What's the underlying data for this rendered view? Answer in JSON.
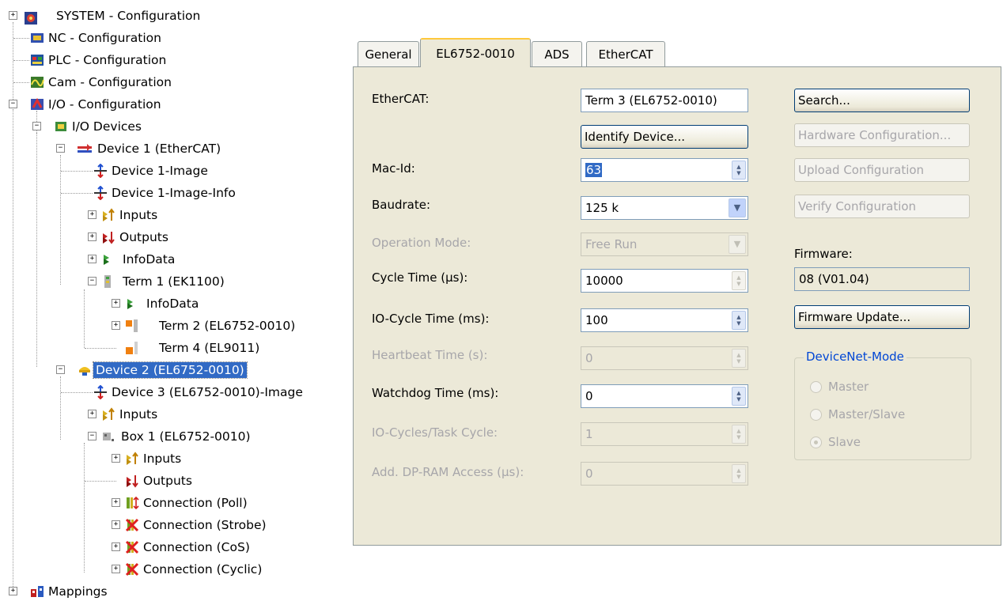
{
  "tree": {
    "items": [
      {
        "label": "SYSTEM - Configuration",
        "icon": "system-config-icon"
      },
      {
        "label": "NC - Configuration",
        "icon": "nc-config-icon"
      },
      {
        "label": "PLC - Configuration",
        "icon": "plc-config-icon"
      },
      {
        "label": "Cam - Configuration",
        "icon": "cam-config-icon"
      },
      {
        "label": "I/O - Configuration",
        "icon": "io-config-icon"
      },
      {
        "label": "I/O Devices",
        "icon": "io-devices-icon"
      },
      {
        "label": "Device 1 (EtherCAT)",
        "icon": "ethercat-device-icon"
      },
      {
        "label": "Device 1-Image",
        "icon": "image-icon"
      },
      {
        "label": "Device 1-Image-Info",
        "icon": "image-icon"
      },
      {
        "label": "Inputs",
        "icon": "inputs-icon"
      },
      {
        "label": "Outputs",
        "icon": "outputs-icon"
      },
      {
        "label": "InfoData",
        "icon": "infodata-icon"
      },
      {
        "label": "Term 1 (EK1100)",
        "icon": "coupler-icon"
      },
      {
        "label": "InfoData",
        "icon": "infodata-icon"
      },
      {
        "label": "Term 2 (EL6752-0010)",
        "icon": "terminal-icon"
      },
      {
        "label": "Term 4 (EL9011)",
        "icon": "end-terminal-icon"
      },
      {
        "label": "Device 2 (EL6752-0010)",
        "icon": "devicenet-device-icon"
      },
      {
        "label": "Device 3 (EL6752-0010)-Image",
        "icon": "image-icon"
      },
      {
        "label": "Inputs",
        "icon": "inputs-icon"
      },
      {
        "label": "Box 1 (EL6752-0010)",
        "icon": "box-icon"
      },
      {
        "label": "Inputs",
        "icon": "inputs-icon"
      },
      {
        "label": "Outputs",
        "icon": "outputs-icon"
      },
      {
        "label": "Connection (Poll)",
        "icon": "connection-poll-icon"
      },
      {
        "label": "Connection (Strobe)",
        "icon": "connection-disabled-icon"
      },
      {
        "label": "Connection (CoS)",
        "icon": "connection-disabled-icon"
      },
      {
        "label": "Connection (Cyclic)",
        "icon": "connection-disabled-icon"
      },
      {
        "label": "Mappings",
        "icon": "mappings-icon"
      }
    ],
    "expander_plus": "+",
    "expander_minus": "−"
  },
  "tabs": [
    "General",
    "EL6752-0010",
    "ADS",
    "EtherCAT"
  ],
  "form": {
    "ethercat_label": "EtherCAT:",
    "ethercat_value": "Term 3 (EL6752-0010)",
    "identify_button": "Identify Device...",
    "mac_id_label": "Mac-Id:",
    "mac_id_value": "63",
    "baudrate_label": "Baudrate:",
    "baudrate_value": "125 k",
    "operation_mode_label": "Operation Mode:",
    "operation_mode_value": "Free Run",
    "cycle_time_label": "Cycle Time (µs):",
    "cycle_time_value": "10000",
    "io_cycle_time_label": "IO-Cycle Time (ms):",
    "io_cycle_time_value": "100",
    "heartbeat_label": "Heartbeat Time (s):",
    "heartbeat_value": "0",
    "watchdog_label": "Watchdog Time (ms):",
    "watchdog_value": "0",
    "io_cycles_label": "IO-Cycles/Task Cycle:",
    "io_cycles_value": "1",
    "dpram_label": "Add. DP-RAM Access (µs):",
    "dpram_value": "0"
  },
  "side": {
    "search_button": "Search...",
    "hardware_config_button": "Hardware Configuration...",
    "upload_config_button": "Upload Configuration",
    "verify_config_button": "Verify Configuration",
    "firmware_label": "Firmware:",
    "firmware_value": "08 (V01.04)",
    "firmware_update_button": "Firmware Update...",
    "devicenet_mode_label": "DeviceNet-Mode",
    "mode_master": "Master",
    "mode_master_slave": "Master/Slave",
    "mode_slave": "Slave"
  },
  "colors": {
    "accent": "#316ac5",
    "tab_highlight": "#ffc83c",
    "devicenet_group_title": "#0046d5"
  }
}
